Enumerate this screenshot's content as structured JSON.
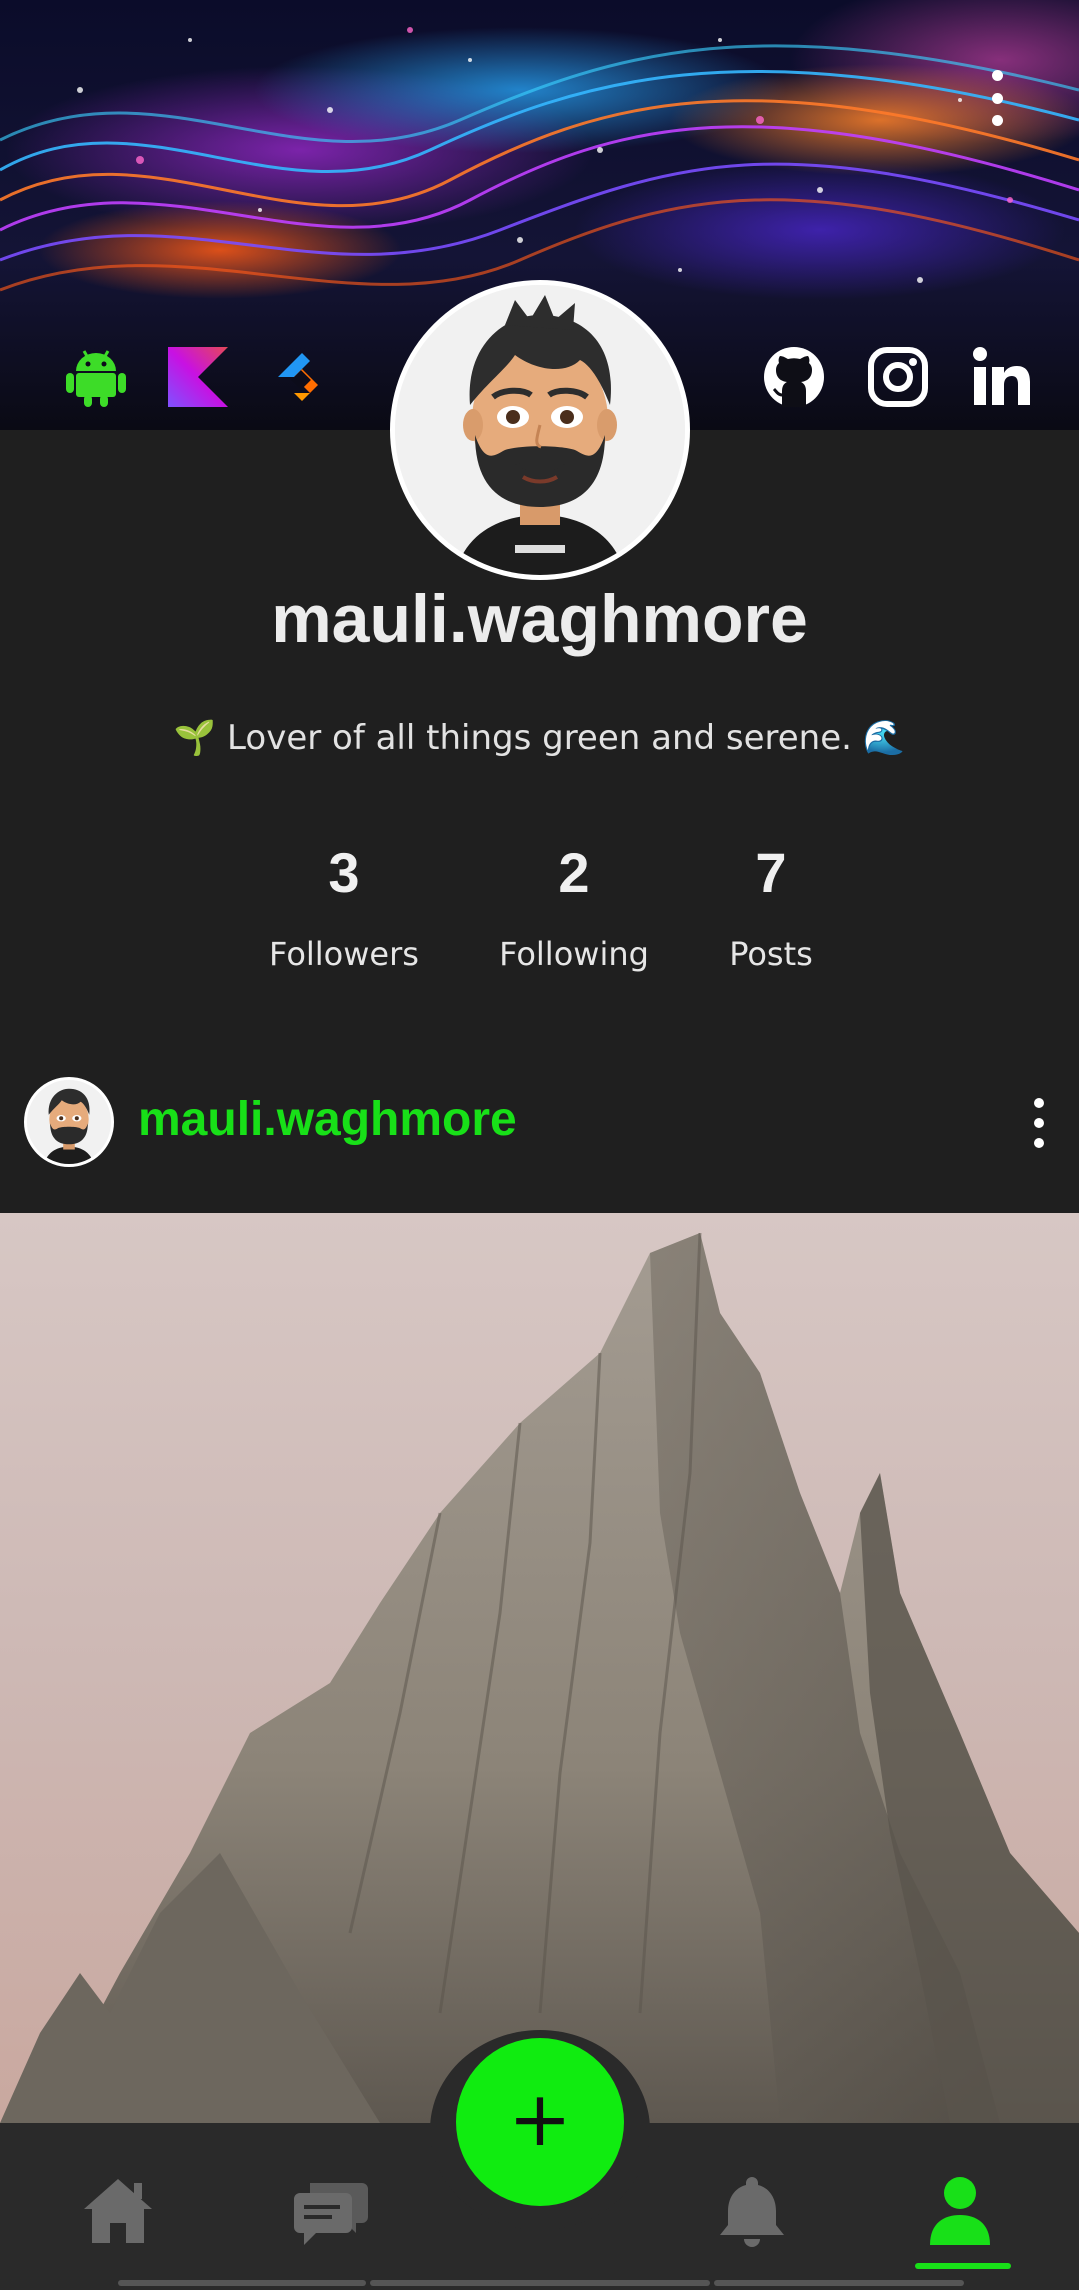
{
  "profile": {
    "username": "mauli.waghmore",
    "bio": "🌱 Lover of all things green and serene. 🌊",
    "stats": [
      {
        "value": "3",
        "label": "Followers"
      },
      {
        "value": "2",
        "label": "Following"
      },
      {
        "value": "7",
        "label": "Posts"
      }
    ]
  },
  "tech_icons": [
    "android-icon",
    "kotlin-icon",
    "jetpack-compose-icon"
  ],
  "social_icons": [
    "github-icon",
    "instagram-icon",
    "linkedin-icon"
  ],
  "post": {
    "username": "mauli.waghmore",
    "image": "mountain-peak-photo"
  },
  "nav": {
    "items": [
      "home",
      "chat",
      "notifications",
      "profile"
    ],
    "active": "profile",
    "fab_label": "+"
  },
  "colors": {
    "accent": "#18e018",
    "background": "#1f1f1f",
    "nav_background": "#2a2a2a"
  }
}
